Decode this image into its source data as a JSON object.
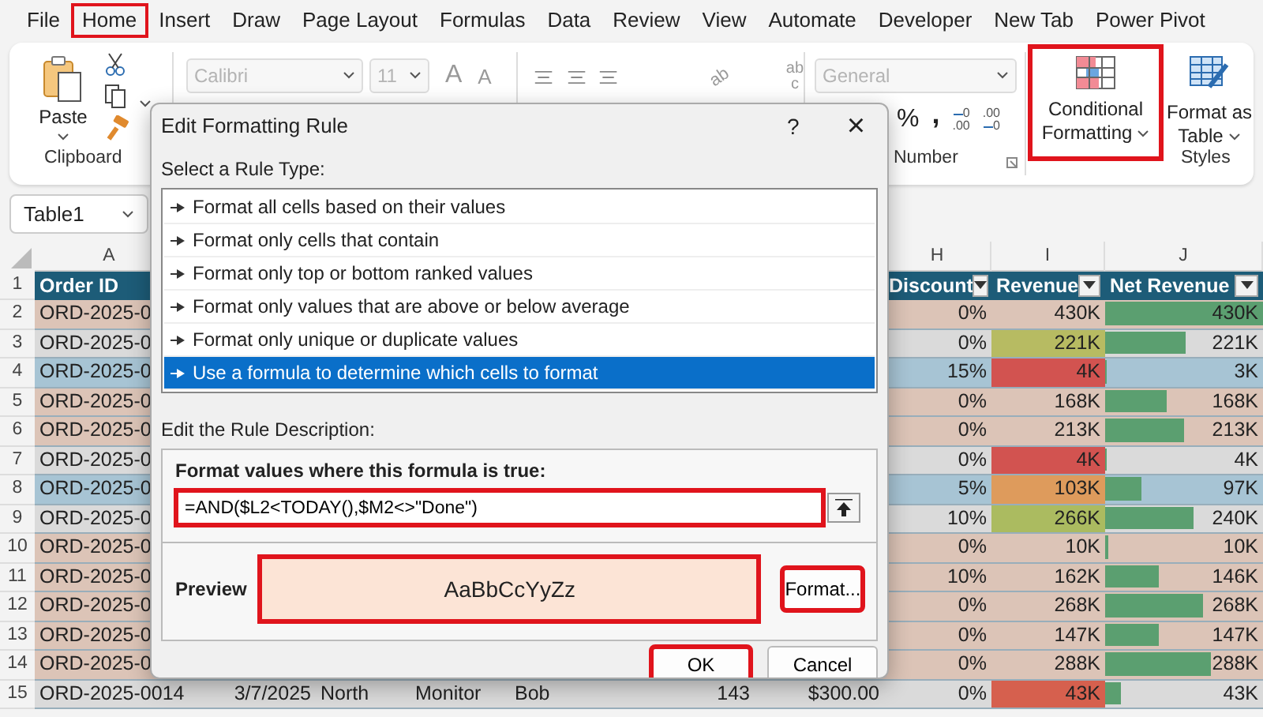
{
  "menu_tabs": [
    {
      "label": "File",
      "highlighted": false
    },
    {
      "label": "Home",
      "highlighted": true
    },
    {
      "label": "Insert",
      "highlighted": false
    },
    {
      "label": "Draw",
      "highlighted": false
    },
    {
      "label": "Page Layout",
      "highlighted": false
    },
    {
      "label": "Formulas",
      "highlighted": false
    },
    {
      "label": "Data",
      "highlighted": false
    },
    {
      "label": "Review",
      "highlighted": false
    },
    {
      "label": "View",
      "highlighted": false
    },
    {
      "label": "Automate",
      "highlighted": false
    },
    {
      "label": "Developer",
      "highlighted": false
    },
    {
      "label": "New Tab",
      "highlighted": false
    },
    {
      "label": "Power Pivot",
      "highlighted": false
    }
  ],
  "ribbon": {
    "clipboard": {
      "paste_label": "Paste",
      "group_label": "Clipboard"
    },
    "font": {
      "font_name": "Calibri",
      "font_size": "11",
      "disabled": true,
      "grow": "A",
      "shrink": "A"
    },
    "alignment": {
      "orientation_label": "ab",
      "wrap_top": "ab",
      "wrap_bottom": "c"
    },
    "number": {
      "format": "General",
      "disabled": true,
      "percent": "%",
      "comma": ",",
      "increase_decimal": [
        "0",
        ".00"
      ],
      "decrease_decimal": [
        ".00",
        "0"
      ],
      "group_label": "Number"
    },
    "styles": {
      "conditional_formatting": {
        "lines": [
          "Conditional",
          "Formatting"
        ],
        "highlighted": true
      },
      "format_as_table": {
        "lines": [
          "Format as",
          "Table"
        ],
        "highlighted": false
      },
      "group_label": "Styles"
    }
  },
  "name_box": {
    "value": "Table1"
  },
  "sheet": {
    "header_row_number": "1",
    "columns": [
      {
        "letter": "A",
        "title": "Order ID"
      },
      {
        "letter": "H",
        "title": "Discount",
        "filter": true
      },
      {
        "letter": "I",
        "title": "Revenue",
        "filter": true
      },
      {
        "letter": "J",
        "title": "Net Revenue",
        "filter": true
      }
    ],
    "rows": [
      {
        "num": "2",
        "color": "#dcc4b7",
        "cells": {
          "order_id": "ORD-2025-0",
          "discount": "0%",
          "revenue": {
            "text": "430K"
          },
          "net_revenue": "430K"
        },
        "level": 1
      },
      {
        "num": "3",
        "color": "#dadada",
        "cells": {
          "order_id": "ORD-2025-0",
          "discount": "0%",
          "revenue": {
            "text": "221K",
            "color": "#b7bb62"
          },
          "net_revenue": "221K"
        },
        "level": 0.51
      },
      {
        "num": "4",
        "color": "#a7c4d4",
        "cells": {
          "order_id": "ORD-2025-0",
          "discount": "15%",
          "revenue": {
            "text": "4K",
            "color": "#d25350"
          },
          "net_revenue": "3K"
        },
        "level": 0.01
      },
      {
        "num": "5",
        "color": "#dcc4b7",
        "cells": {
          "order_id": "ORD-2025-0",
          "discount": "0%",
          "revenue": {
            "text": "168K"
          },
          "net_revenue": "168K"
        },
        "level": 0.39
      },
      {
        "num": "6",
        "color": "#dcc4b7",
        "cells": {
          "order_id": "ORD-2025-0",
          "discount": "0%",
          "revenue": {
            "text": "213K"
          },
          "net_revenue": "213K"
        },
        "level": 0.5
      },
      {
        "num": "7",
        "color": "#dadada",
        "cells": {
          "order_id": "ORD-2025-0",
          "discount": "0%",
          "revenue": {
            "text": "4K",
            "color": "#d25350"
          },
          "net_revenue": "4K"
        },
        "level": 0.01
      },
      {
        "num": "8",
        "color": "#a7c4d4",
        "cells": {
          "order_id": "ORD-2025-0",
          "discount": "5%",
          "revenue": {
            "text": "103K",
            "color": "#de9b5c"
          },
          "net_revenue": "97K"
        },
        "level": 0.23
      },
      {
        "num": "9",
        "color": "#dadada",
        "cells": {
          "order_id": "ORD-2025-0",
          "discount": "10%",
          "revenue": {
            "text": "266K",
            "color": "#abbb60"
          },
          "net_revenue": "240K"
        },
        "level": 0.56
      },
      {
        "num": "10",
        "color": "#dcc4b7",
        "cells": {
          "order_id": "ORD-2025-0",
          "discount": "0%",
          "revenue": {
            "text": "10K"
          },
          "net_revenue": "10K"
        },
        "level": 0.02
      },
      {
        "num": "11",
        "color": "#dcc4b7",
        "cells": {
          "order_id": "ORD-2025-0",
          "discount": "10%",
          "revenue": {
            "text": "162K"
          },
          "net_revenue": "146K"
        },
        "level": 0.34
      },
      {
        "num": "12",
        "color": "#dcc4b7",
        "cells": {
          "order_id": "ORD-2025-0",
          "discount": "0%",
          "revenue": {
            "text": "268K"
          },
          "net_revenue": "268K"
        },
        "level": 0.62
      },
      {
        "num": "13",
        "color": "#dcc4b7",
        "cells": {
          "order_id": "ORD-2025-0",
          "discount": "0%",
          "revenue": {
            "text": "147K"
          },
          "net_revenue": "147K"
        },
        "level": 0.34
      },
      {
        "num": "14",
        "color": "#dcc4b7",
        "cells": {
          "order_id": "ORD-2025-0",
          "discount": "0%",
          "revenue": {
            "text": "288K"
          },
          "net_revenue": "288K"
        },
        "level": 0.67
      },
      {
        "num": "15",
        "color": "#dadada",
        "cells": {
          "order_id": "ORD-2025-0014",
          "date": "3/7/2025",
          "region": "North",
          "product": "Monitor",
          "rep": "Bob",
          "quantity": "143",
          "price": "$300.00",
          "discount": "0%",
          "revenue": {
            "text": "43K",
            "color": "#d6604e"
          },
          "net_revenue": "43K"
        },
        "level": 0.1
      }
    ]
  },
  "dialog": {
    "title": "Edit Formatting Rule",
    "help": "?",
    "close": "×",
    "rule_type_label": "Select a Rule Type:",
    "rule_types": [
      {
        "label": "Format all cells based on their values",
        "selected": false
      },
      {
        "label": "Format only cells that contain",
        "selected": false
      },
      {
        "label": "Format only top or bottom ranked values",
        "selected": false
      },
      {
        "label": "Format only values that are above or below average",
        "selected": false
      },
      {
        "label": "Format only unique or duplicate values",
        "selected": false
      },
      {
        "label": "Use a formula to determine which cells to format",
        "selected": true
      }
    ],
    "description_label": "Edit the Rule Description:",
    "formula_label": "Format values where this formula is true:",
    "formula": {
      "value": "=AND($L2<TODAY(),$M2<>\"Done\")",
      "highlighted": true
    },
    "preview_label": "Preview",
    "preview": {
      "text": "AaBbCcYyZz",
      "color": "#fce4d6",
      "highlighted": true
    },
    "buttons": [
      {
        "kind": "format",
        "label": "Format...",
        "highlighted": true
      },
      {
        "kind": "ok",
        "label": "OK",
        "highlighted": true
      },
      {
        "kind": "cancel",
        "label": "Cancel",
        "highlighted": false
      }
    ]
  }
}
